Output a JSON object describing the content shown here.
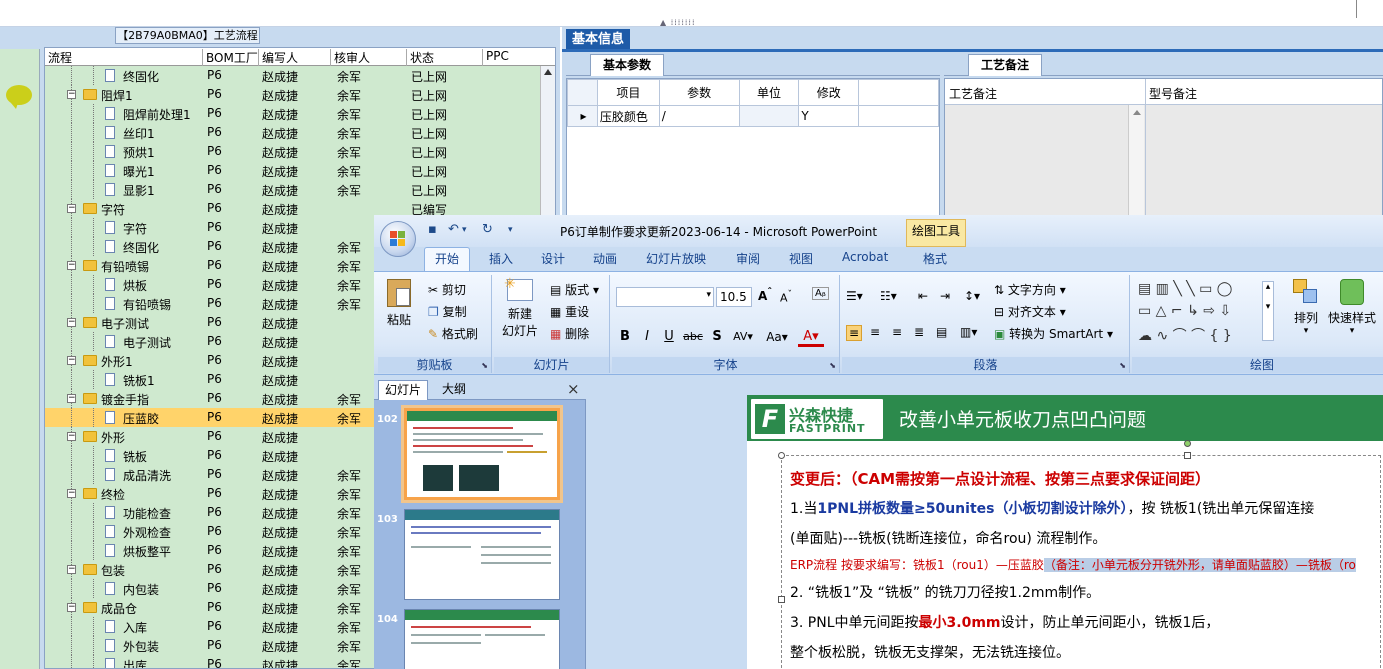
{
  "left_panel": {
    "tree_title": "【2B79A0BMA0】工艺流程",
    "columns": [
      "流程",
      "BOM工厂",
      "编写人",
      "核审人",
      "状态",
      "PPC"
    ],
    "rows": [
      {
        "name": "终固化",
        "level": 2,
        "kind": "doc",
        "bom": "P6",
        "writer": "赵成捷",
        "reviewer": "余军",
        "status": "已上网"
      },
      {
        "name": "阻焊1",
        "level": 1,
        "kind": "folder",
        "bom": "P6",
        "writer": "赵成捷",
        "reviewer": "余军",
        "status": "已上网"
      },
      {
        "name": "阻焊前处理1",
        "level": 2,
        "kind": "doc",
        "bom": "P6",
        "writer": "赵成捷",
        "reviewer": "余军",
        "status": "已上网"
      },
      {
        "name": "丝印1",
        "level": 2,
        "kind": "doc",
        "bom": "P6",
        "writer": "赵成捷",
        "reviewer": "余军",
        "status": "已上网"
      },
      {
        "name": "预烘1",
        "level": 2,
        "kind": "doc",
        "bom": "P6",
        "writer": "赵成捷",
        "reviewer": "余军",
        "status": "已上网"
      },
      {
        "name": "曝光1",
        "level": 2,
        "kind": "doc",
        "bom": "P6",
        "writer": "赵成捷",
        "reviewer": "余军",
        "status": "已上网"
      },
      {
        "name": "显影1",
        "level": 2,
        "kind": "doc",
        "bom": "P6",
        "writer": "赵成捷",
        "reviewer": "余军",
        "status": "已上网"
      },
      {
        "name": "字符",
        "level": 1,
        "kind": "folder",
        "bom": "P6",
        "writer": "赵成捷",
        "reviewer": "",
        "status": "已编写"
      },
      {
        "name": "字符",
        "level": 2,
        "kind": "doc",
        "bom": "P6",
        "writer": "赵成捷",
        "reviewer": "",
        "status": ""
      },
      {
        "name": "终固化",
        "level": 2,
        "kind": "doc",
        "bom": "P6",
        "writer": "赵成捷",
        "reviewer": "余军",
        "status": ""
      },
      {
        "name": "有铅喷锡",
        "level": 1,
        "kind": "folder",
        "bom": "P6",
        "writer": "赵成捷",
        "reviewer": "余军",
        "status": ""
      },
      {
        "name": "烘板",
        "level": 2,
        "kind": "doc",
        "bom": "P6",
        "writer": "赵成捷",
        "reviewer": "余军",
        "status": ""
      },
      {
        "name": "有铅喷锡",
        "level": 2,
        "kind": "doc",
        "bom": "P6",
        "writer": "赵成捷",
        "reviewer": "余军",
        "status": ""
      },
      {
        "name": "电子测试",
        "level": 1,
        "kind": "folder",
        "bom": "P6",
        "writer": "赵成捷",
        "reviewer": "",
        "status": ""
      },
      {
        "name": "电子测试",
        "level": 2,
        "kind": "doc",
        "bom": "P6",
        "writer": "赵成捷",
        "reviewer": "",
        "status": ""
      },
      {
        "name": "外形1",
        "level": 1,
        "kind": "folder",
        "bom": "P6",
        "writer": "赵成捷",
        "reviewer": "",
        "status": ""
      },
      {
        "name": "铣板1",
        "level": 2,
        "kind": "doc",
        "bom": "P6",
        "writer": "赵成捷",
        "reviewer": "",
        "status": ""
      },
      {
        "name": "镀金手指",
        "level": 1,
        "kind": "folder",
        "bom": "P6",
        "writer": "赵成捷",
        "reviewer": "余军",
        "status": ""
      },
      {
        "name": "压蓝胶",
        "level": 2,
        "kind": "doc",
        "bom": "P6",
        "writer": "赵成捷",
        "reviewer": "余军",
        "status": "",
        "selected": true
      },
      {
        "name": "外形",
        "level": 1,
        "kind": "folder",
        "bom": "P6",
        "writer": "赵成捷",
        "reviewer": "",
        "status": ""
      },
      {
        "name": "铣板",
        "level": 2,
        "kind": "doc",
        "bom": "P6",
        "writer": "赵成捷",
        "reviewer": "",
        "status": ""
      },
      {
        "name": "成品清洗",
        "level": 2,
        "kind": "doc",
        "bom": "P6",
        "writer": "赵成捷",
        "reviewer": "余军",
        "status": ""
      },
      {
        "name": "终检",
        "level": 1,
        "kind": "folder",
        "bom": "P6",
        "writer": "赵成捷",
        "reviewer": "余军",
        "status": ""
      },
      {
        "name": "功能检查",
        "level": 2,
        "kind": "doc",
        "bom": "P6",
        "writer": "赵成捷",
        "reviewer": "余军",
        "status": ""
      },
      {
        "name": "外观检查",
        "level": 2,
        "kind": "doc",
        "bom": "P6",
        "writer": "赵成捷",
        "reviewer": "余军",
        "status": ""
      },
      {
        "name": "烘板整平",
        "level": 2,
        "kind": "doc",
        "bom": "P6",
        "writer": "赵成捷",
        "reviewer": "余军",
        "status": ""
      },
      {
        "name": "包装",
        "level": 1,
        "kind": "folder",
        "bom": "P6",
        "writer": "赵成捷",
        "reviewer": "余军",
        "status": ""
      },
      {
        "name": "内包装",
        "level": 2,
        "kind": "doc",
        "bom": "P6",
        "writer": "赵成捷",
        "reviewer": "余军",
        "status": ""
      },
      {
        "name": "成品仓",
        "level": 1,
        "kind": "folder",
        "bom": "P6",
        "writer": "赵成捷",
        "reviewer": "余军",
        "status": ""
      },
      {
        "name": "入库",
        "level": 2,
        "kind": "doc",
        "bom": "P6",
        "writer": "赵成捷",
        "reviewer": "余军",
        "status": ""
      },
      {
        "name": "外包装",
        "level": 2,
        "kind": "doc",
        "bom": "P6",
        "writer": "赵成捷",
        "reviewer": "余军",
        "status": ""
      },
      {
        "name": "出库",
        "level": 2,
        "kind": "doc",
        "bom": "P6",
        "writer": "赵成捷",
        "reviewer": "余军",
        "status": ""
      }
    ]
  },
  "right_panel": {
    "basic_info_tab": "基本信息",
    "params_tab": "基本参数",
    "params_columns": [
      "项目",
      "参数",
      "单位",
      "修改"
    ],
    "params_row": {
      "item": "压胶颜色",
      "param": "/",
      "unit": "",
      "modify": "Y"
    },
    "remarks_tab": "工艺备注",
    "remarks_columns": [
      "工艺备注",
      "型号备注"
    ]
  },
  "ppt": {
    "title": "P6订单制作要求更新2023-06-14 - Microsoft PowerPoint",
    "context_tab": "绘图工具",
    "tabs": [
      "开始",
      "插入",
      "设计",
      "动画",
      "幻灯片放映",
      "审阅",
      "视图",
      "Acrobat",
      "格式"
    ],
    "clipboard": {
      "paste": "粘贴",
      "cut": "剪切",
      "copy": "复制",
      "format_painter": "格式刷",
      "label": "剪贴板"
    },
    "slides_group": {
      "new_slide_1": "新建",
      "new_slide_2": "幻灯片",
      "layout": "版式",
      "reset": "重设",
      "delete": "删除",
      "label": "幻灯片"
    },
    "font": {
      "size": "10.5",
      "label": "字体"
    },
    "paragraph": {
      "text_direction": "文字方向",
      "align_text": "对齐文本",
      "smartart": "转换为 SmartArt",
      "label": "段落"
    },
    "drawing": {
      "arrange": "排列",
      "quick_styles": "快速样式",
      "label": "绘图"
    },
    "slides_panel": {
      "tab_slides": "幻灯片",
      "tab_outline": "大纲",
      "close": "×",
      "thumb_numbers": [
        "102",
        "103",
        "104"
      ]
    },
    "slide": {
      "logo_cn": "兴森快捷",
      "logo_en": "FASTPRINT",
      "title": "改善小单元板收刀点凹凸问题",
      "l1_a": "变更后：（CAM需按第一点设计流程、按第三点要求保证间距）",
      "l2_a": "1.当",
      "l2_b": "1PNL拼板数量≥50unites（小板切割设计除外）",
      "l2_c": "，按 铣板1(铣出单元保留连接",
      "l3": "(单面贴)---铣板(铣断连接位，命名rou) 流程制作。",
      "l4_a": "ERP流程 按要求编写：铣板1（rou1）—压蓝胶",
      "l4_b": "（备注：小单元板分开铣外形，请单面贴蓝胶）—铣板（ro",
      "l5": "2. “铣板1”及 “铣板” 的铣刀刀径按1.2mm制作。",
      "l6_a": "3. PNL中单元间距按",
      "l6_b": "最小3.0mm",
      "l6_c": "设计，防止单元间距小，铣板1后，",
      "l7": "整个板松脱，铣板无支撑架，无法铣连接位。"
    }
  }
}
